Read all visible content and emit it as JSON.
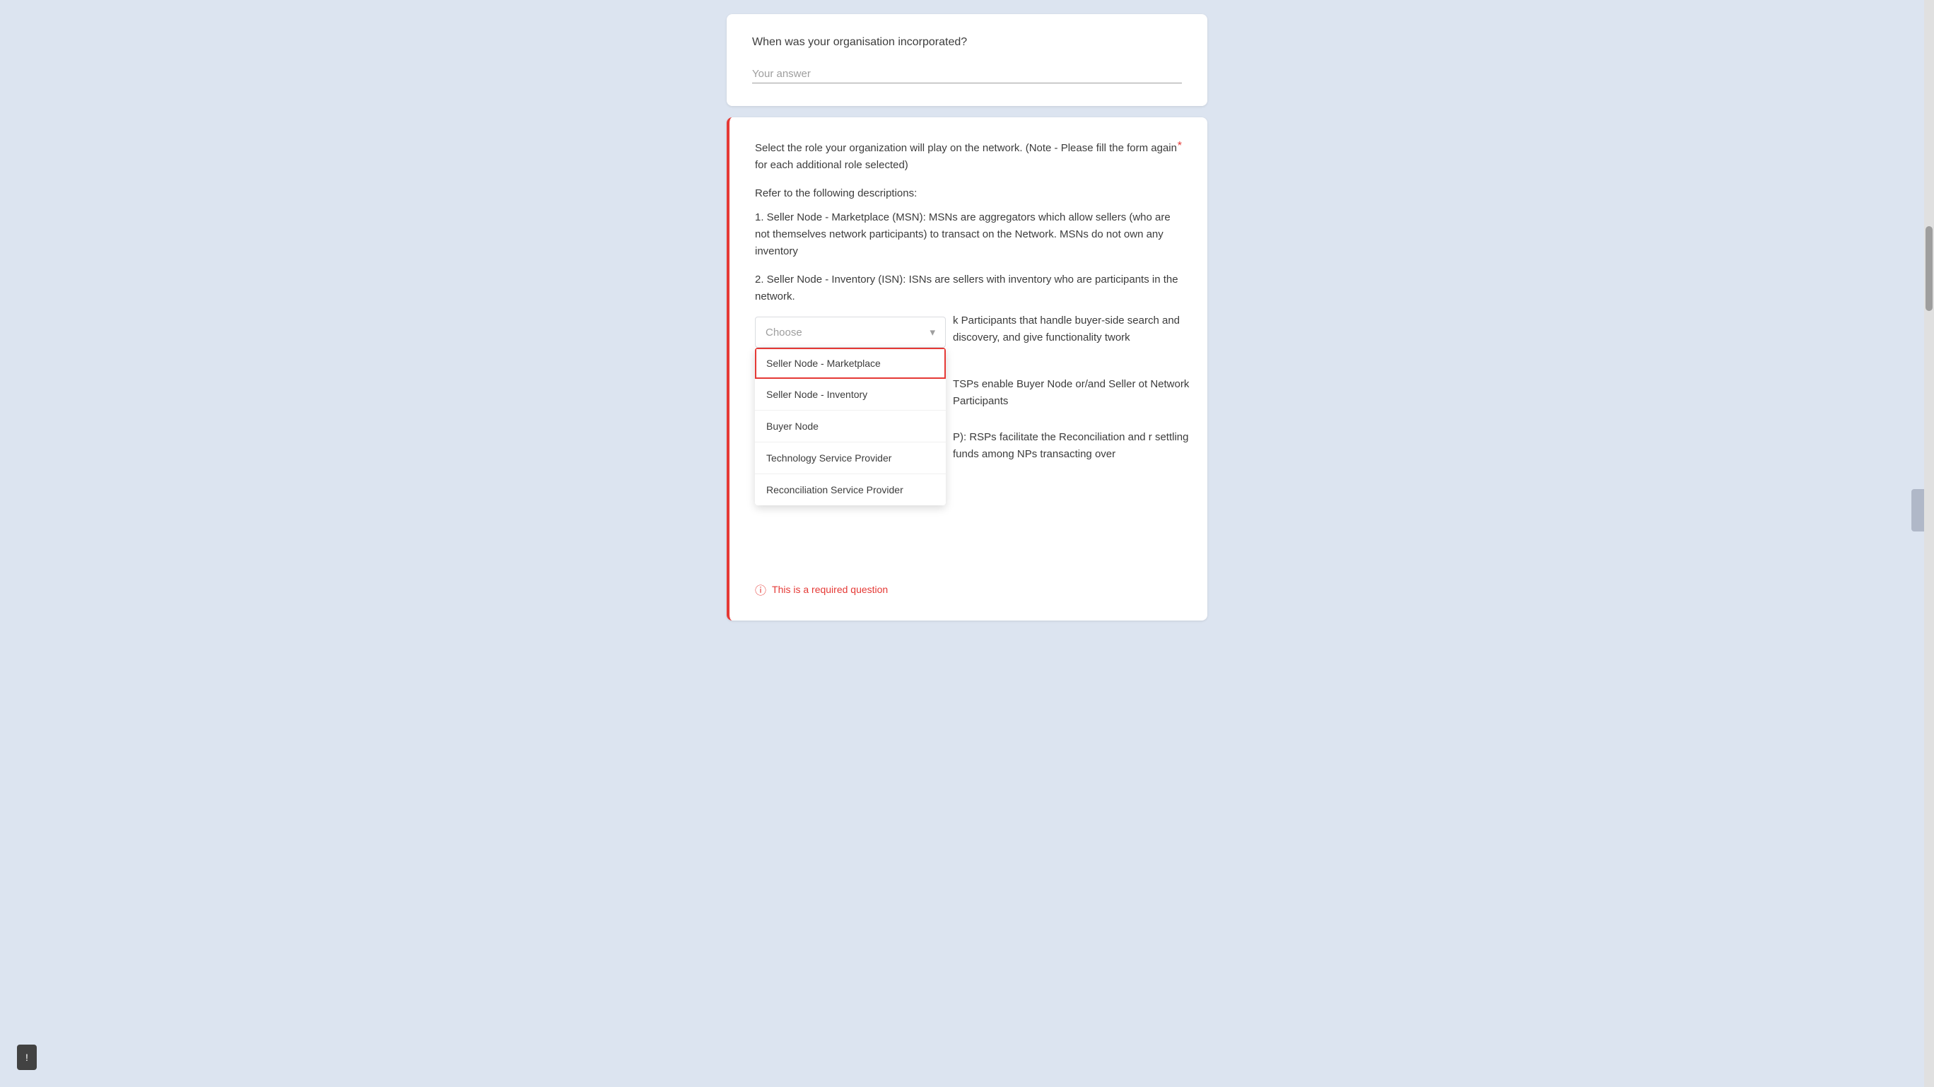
{
  "topCard": {
    "question": "When was your organisation incorporated?",
    "input_placeholder": "Your answer"
  },
  "mainCard": {
    "question_text": "Select the role your organization will play on the network. (Note - Please fill the form again for each additional role selected)",
    "required_star": "*",
    "refer_label": "Refer to the following descriptions:",
    "item1": "1. Seller Node - Marketplace (MSN): MSNs are aggregators which allow sellers (who are not themselves network participants) to transact on the Network. MSNs do not own any inventory",
    "item2": "2. Seller Node - Inventory (ISN): ISNs are sellers with inventory who are participants in the network.",
    "background_text_3": "k Participants that handle buyer-side search and discovery, and give functionality twork",
    "background_text_4": "TSPs enable Buyer Node or/and Seller ot Network Participants",
    "background_text_5": "P): RSPs facilitate the Reconciliation and r settling funds among NPs transacting over",
    "dropdown": {
      "placeholder": "Choose",
      "options": [
        "Seller Node - Marketplace",
        "Seller Node - Inventory",
        "Buyer Node",
        "Technology Service Provider",
        "Reconciliation Service Provider"
      ],
      "selected_index": 0
    },
    "error_text": "This is a required question"
  },
  "feedback_label": "!",
  "icons": {
    "exclamation": "!",
    "chevron_down": "▾"
  }
}
